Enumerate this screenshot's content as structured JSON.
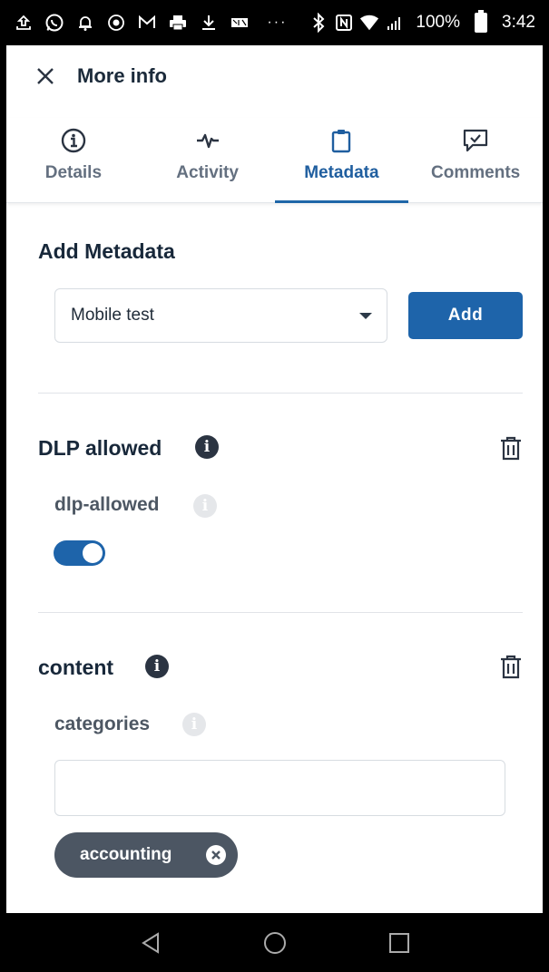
{
  "status_bar": {
    "battery": "100%",
    "time": "3:42",
    "overflow": "···",
    "icons": [
      "upload-icon",
      "whatsapp-icon",
      "bell-icon",
      "record-icon",
      "gmail-icon",
      "print-icon",
      "download-icon",
      "mail-badge-icon",
      "bluetooth-icon",
      "nfc-icon",
      "wifi-icon",
      "signal-icon",
      "battery-icon"
    ]
  },
  "header": {
    "title": "More info"
  },
  "tabs": [
    {
      "label": "Details",
      "icon": "info-icon",
      "active": false
    },
    {
      "label": "Activity",
      "icon": "activity-icon",
      "active": false
    },
    {
      "label": "Metadata",
      "icon": "clipboard-icon",
      "active": true
    },
    {
      "label": "Comments",
      "icon": "comment-icon",
      "active": false
    }
  ],
  "add_metadata": {
    "title": "Add Metadata",
    "selected_template": "Mobile test",
    "add_label": "Add"
  },
  "templates": [
    {
      "title": "DLP allowed",
      "field": {
        "label": "dlp-allowed",
        "type": "toggle",
        "value": true
      }
    },
    {
      "title": "content",
      "field": {
        "label": "categories",
        "type": "tags",
        "input_value": "",
        "tags": [
          "accounting"
        ]
      }
    }
  ],
  "colors": {
    "accent": "#1e64aa",
    "heading": "#18283a",
    "chip": "#4c5663"
  }
}
